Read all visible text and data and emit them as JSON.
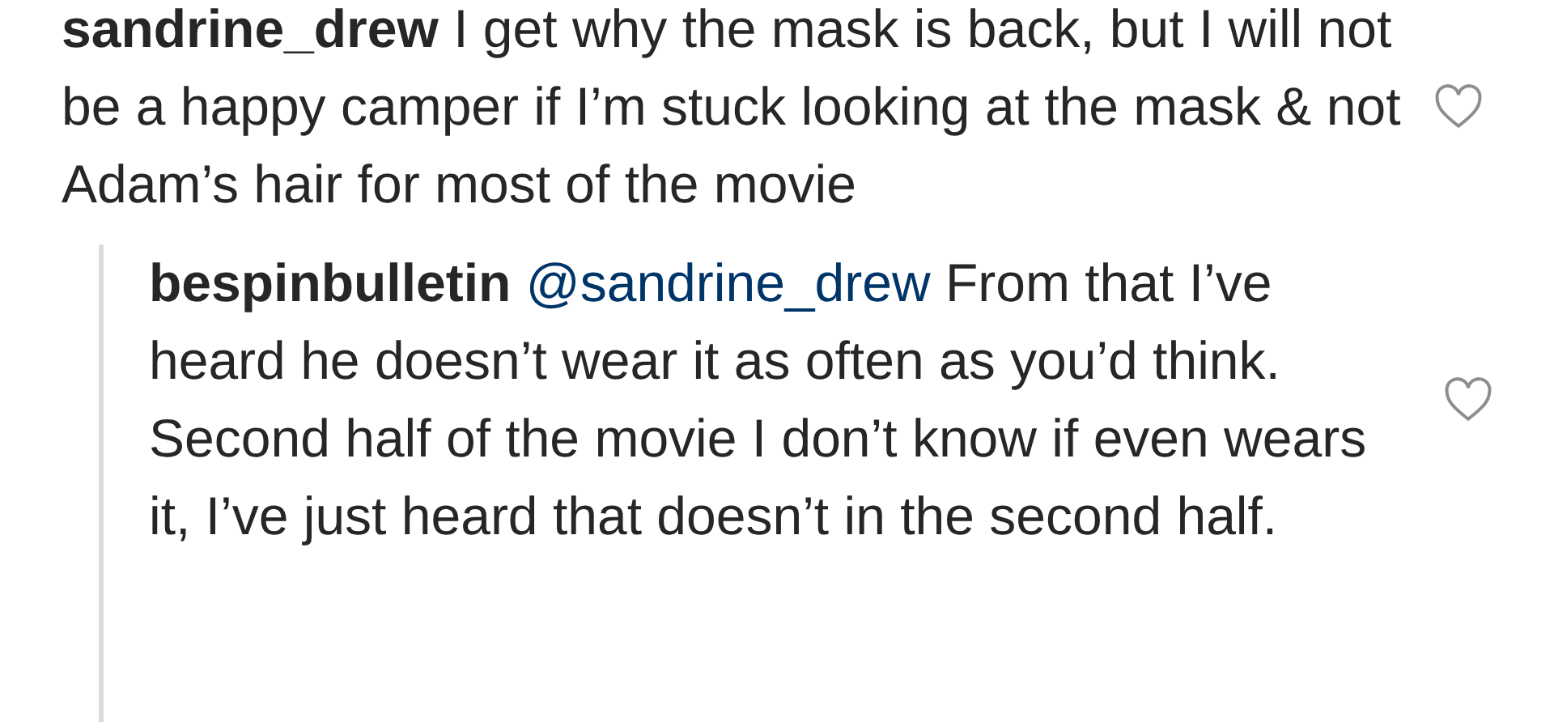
{
  "comment": {
    "username": "sandrine_drew",
    "text": "I get why the mask is back, but I will not be a happy camper if I’m stuck looking at the mask & not Adam’s hair for most of the movie"
  },
  "reply": {
    "username": "bespinbulletin",
    "mention": "@sandrine_drew",
    "text": "From that I’ve heard he doesn’t wear it as often as you’d think. Second half of the movie I don’t know if even wears it, I’ve just heard that doesn’t in the second half."
  }
}
